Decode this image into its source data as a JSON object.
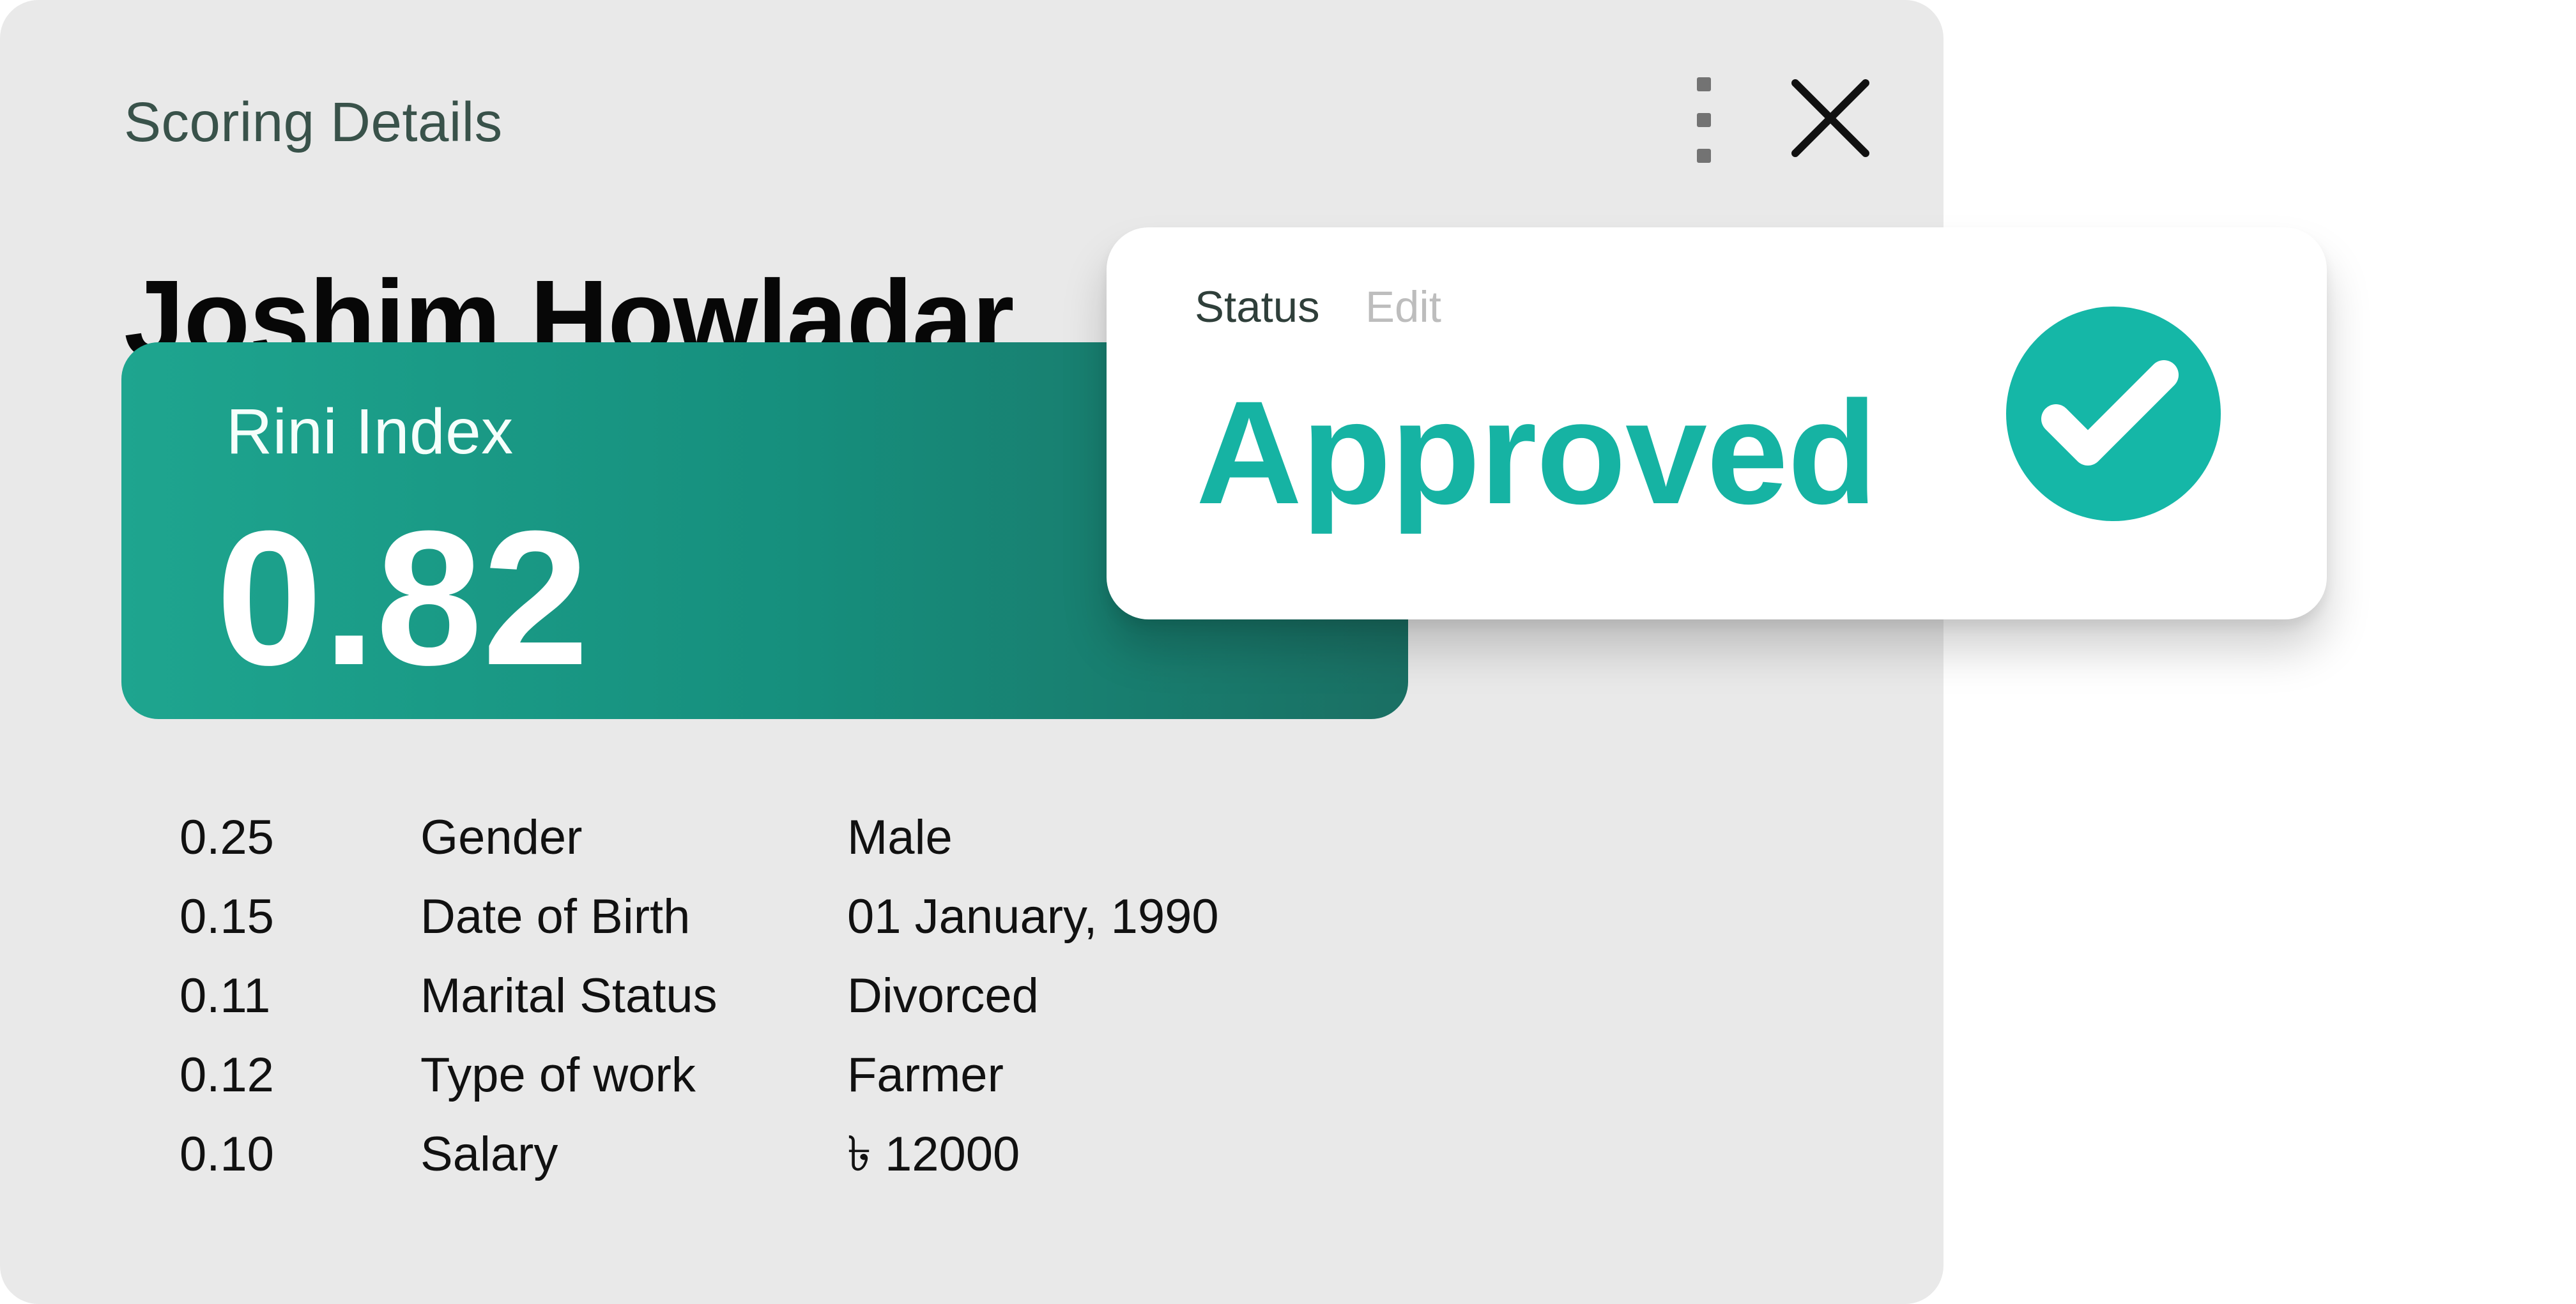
{
  "app": {
    "eyebrow": "Scoring Details",
    "title": "Joshim Howladar"
  },
  "controls": {
    "menu_icon": "more-vertical-icon",
    "close_icon": "close-icon"
  },
  "index": {
    "label": "Rini Index",
    "value": "0.82"
  },
  "details": [
    {
      "score": "0.25",
      "label": "Gender",
      "value": "Male"
    },
    {
      "score": "0.15",
      "label": "Date of Birth",
      "value": "01 January, 1990"
    },
    {
      "score": "0.11",
      "label": "Marital Status",
      "value": "Divorced"
    },
    {
      "score": "0.12",
      "label": "Type of work",
      "value": "Farmer"
    },
    {
      "score": "0.10",
      "label": "Salary",
      "value": "৳ 12000"
    }
  ],
  "status": {
    "label": "Status",
    "edit_label": "Edit",
    "value": "Approved",
    "icon": "check-circle-icon"
  },
  "colors": {
    "card_background": "#e9e9e9",
    "accent": "#16b3a3",
    "index_green": "#168f7d"
  }
}
